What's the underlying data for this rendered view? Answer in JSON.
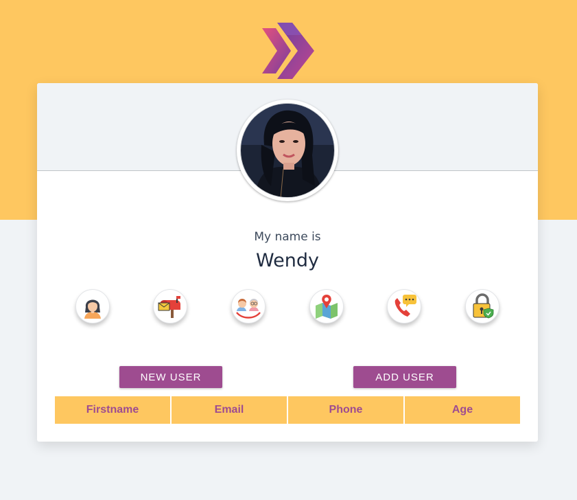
{
  "brand": {
    "logo_icon": "double-chevron-logo-icon",
    "colors": {
      "primary": "#9e4c90",
      "accent": "#fec760",
      "background": "#f0f3f6"
    }
  },
  "profile": {
    "avatar": "user-photo",
    "title": "My name is",
    "value": "Wendy"
  },
  "info_icons": [
    {
      "name": "person-icon"
    },
    {
      "name": "mailbox-icon"
    },
    {
      "name": "age-faces-icon"
    },
    {
      "name": "map-pin-icon"
    },
    {
      "name": "phone-chat-icon"
    },
    {
      "name": "padlock-icon"
    }
  ],
  "buttons": {
    "new_user": "NEW USER",
    "add_user": "ADD USER"
  },
  "table": {
    "headers": [
      "Firstname",
      "Email",
      "Phone",
      "Age"
    ]
  }
}
